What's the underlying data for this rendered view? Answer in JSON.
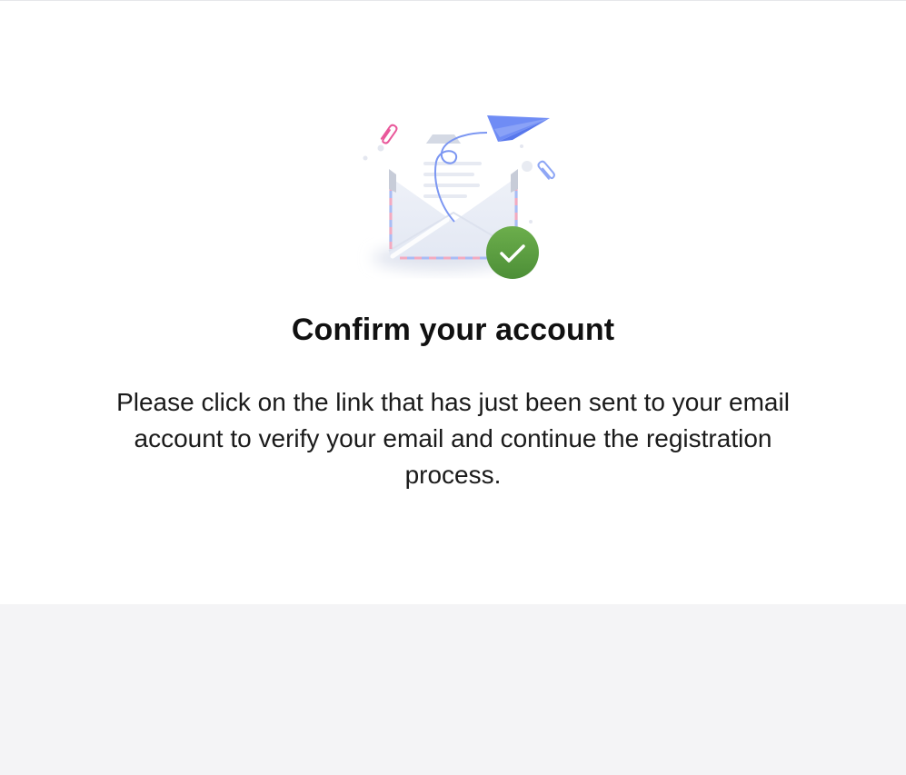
{
  "confirmation": {
    "title": "Confirm your account",
    "message": "Please click on the link that has just been sent to your email account to verify your email and continue the registration process."
  },
  "colors": {
    "accent_blue": "#6f8cf5",
    "success_green": "#5a9e3f",
    "paperclip_pink": "#e9579a",
    "footer_bg": "#f4f4f6"
  },
  "icons": {
    "illustration": "email-sent-illustration",
    "check": "check-icon"
  }
}
